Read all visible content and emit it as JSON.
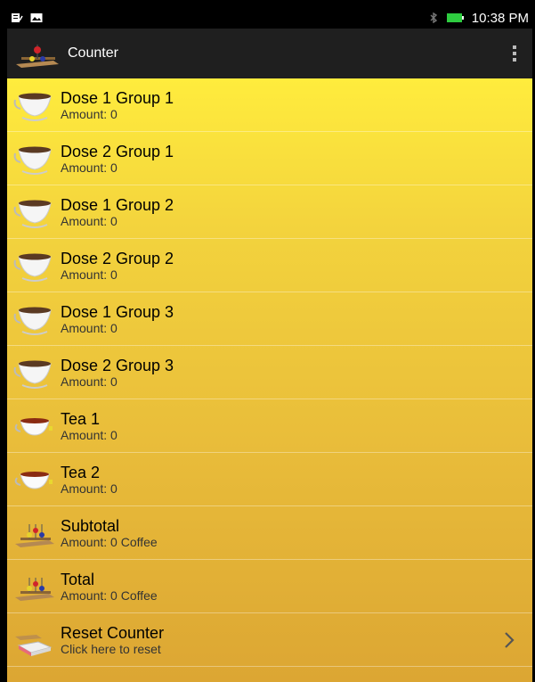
{
  "status_bar": {
    "time": "10:38 PM"
  },
  "action_bar": {
    "title": "Counter"
  },
  "rows": [
    {
      "title": "Dose 1 Group 1",
      "subtitle": "Amount: 0",
      "icon": "coffee-cup-icon"
    },
    {
      "title": "Dose 2 Group 1",
      "subtitle": "Amount: 0",
      "icon": "coffee-cup-icon"
    },
    {
      "title": "Dose 1 Group 2",
      "subtitle": "Amount: 0",
      "icon": "coffee-cup-icon"
    },
    {
      "title": "Dose 2 Group 2",
      "subtitle": "Amount: 0",
      "icon": "coffee-cup-icon"
    },
    {
      "title": "Dose 1 Group 3",
      "subtitle": "Amount: 0",
      "icon": "coffee-cup-icon"
    },
    {
      "title": "Dose 2 Group 3",
      "subtitle": "Amount: 0",
      "icon": "coffee-cup-icon"
    },
    {
      "title": "Tea 1",
      "subtitle": "Amount: 0",
      "icon": "tea-cup-icon"
    },
    {
      "title": "Tea 2",
      "subtitle": "Amount: 0",
      "icon": "tea-cup-icon"
    },
    {
      "title": "Subtotal",
      "subtitle": "Amount: 0 Coffee",
      "icon": "abacus-icon"
    },
    {
      "title": "Total",
      "subtitle": "Amount: 0 Coffee",
      "icon": "abacus-icon"
    },
    {
      "title": "Reset Counter",
      "subtitle": "Click here to reset",
      "icon": "eraser-icon"
    }
  ],
  "colors": {
    "list_top": "#ffec3d",
    "list_bottom": "#dca633",
    "action_bar": "#1f1f1f"
  }
}
